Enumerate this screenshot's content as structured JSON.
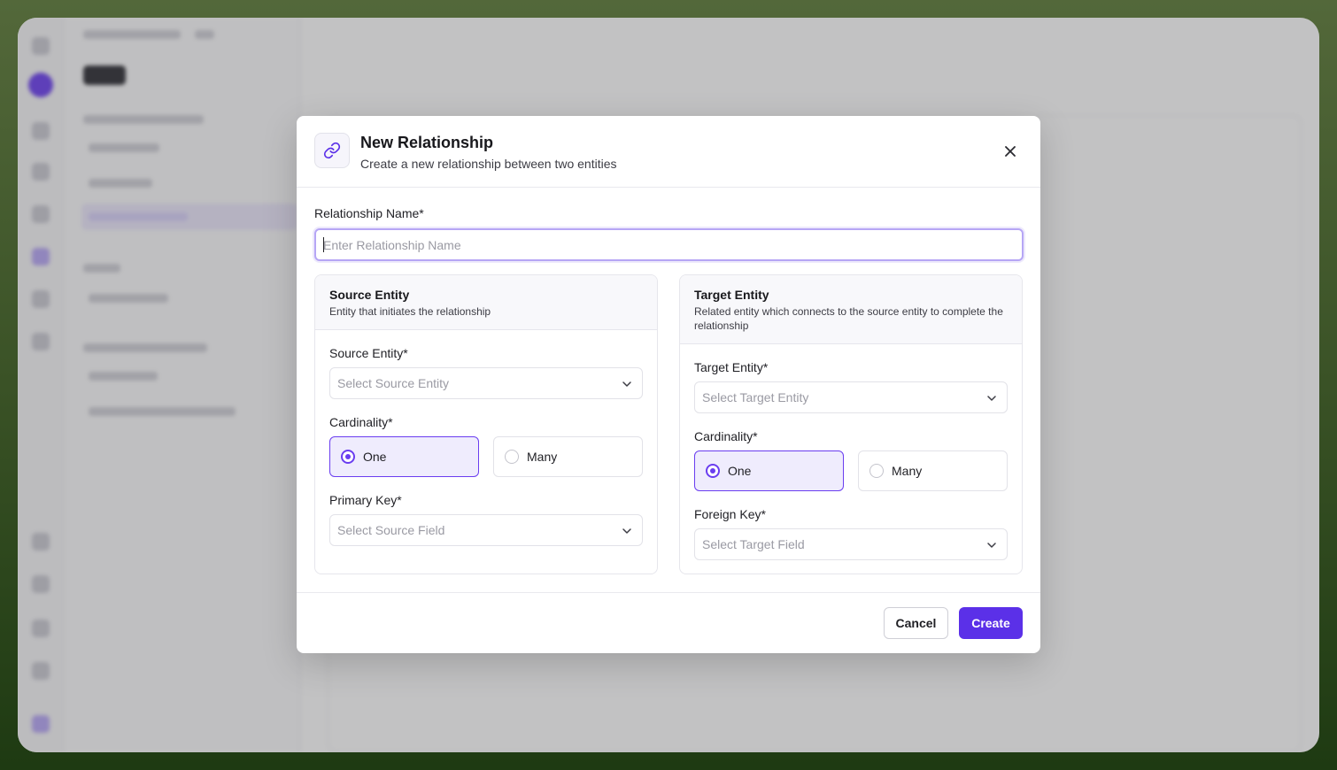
{
  "modal": {
    "title": "New Relationship",
    "subtitle": "Create a new relationship between two entities",
    "header_icon": "link-icon",
    "close_icon": "close-icon"
  },
  "relationship_name": {
    "label": "Relationship Name*",
    "placeholder": "Enter Relationship Name",
    "value": ""
  },
  "source": {
    "title": "Source Entity",
    "description": "Entity that initiates the relationship",
    "entity_label": "Source Entity*",
    "entity_placeholder": "Select Source Entity",
    "cardinality_label": "Cardinality*",
    "cardinality_options": [
      "One",
      "Many"
    ],
    "cardinality_selected": "One",
    "key_label": "Primary Key*",
    "key_placeholder": "Select Source Field"
  },
  "target": {
    "title": "Target Entity",
    "description": "Related entity which connects to the source entity to complete the relationship",
    "entity_label": "Target Entity*",
    "entity_placeholder": "Select Target Entity",
    "cardinality_label": "Cardinality*",
    "cardinality_options": [
      "One",
      "Many"
    ],
    "cardinality_selected": "One",
    "key_label": "Foreign Key*",
    "key_placeholder": "Select Target Field"
  },
  "footer": {
    "cancel_label": "Cancel",
    "create_label": "Create"
  },
  "colors": {
    "accent": "#5b30e8",
    "selected_bg": "#efecfd",
    "focus_border": "#b6a6f5"
  }
}
